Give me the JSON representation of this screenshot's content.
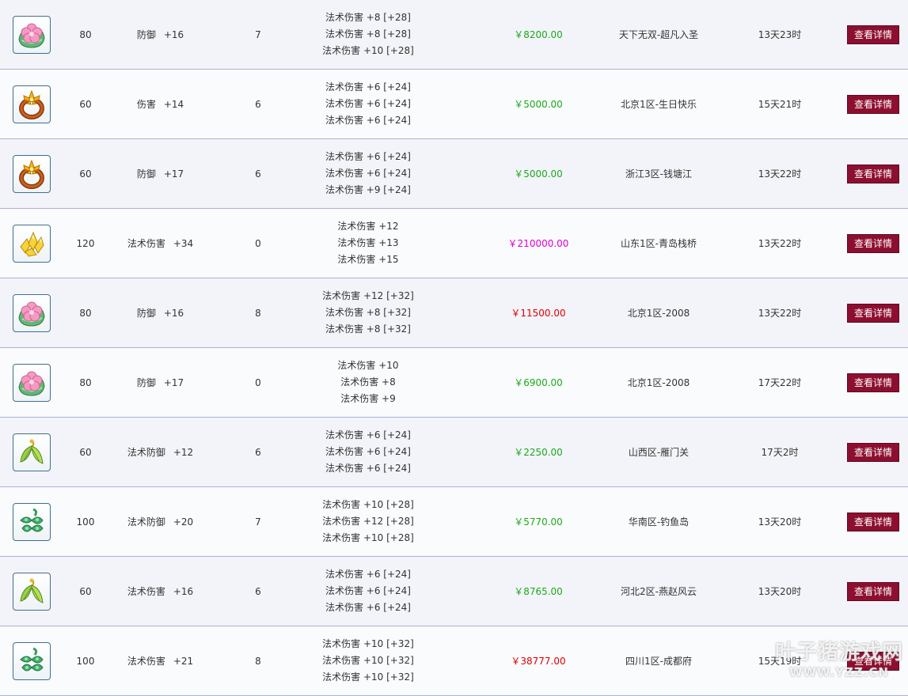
{
  "colors": {
    "row_a": "#f3f4f9",
    "row_b": "#fafbfd",
    "divider": "#a8b2d6",
    "price_green": "#1aaa1a",
    "price_magenta": "#e000d0",
    "price_red": "#e00000",
    "button": "#8d0f2f"
  },
  "rows": [
    {
      "icon": "pink-flower-jade-icon",
      "level": "80",
      "attr_name": "防御",
      "attr_value": "+16",
      "holes": "7",
      "stats": [
        "法术伤害 +8 [+28]",
        "法术伤害 +8 [+28]",
        "法术伤害 +10 [+28]"
      ],
      "price": "￥8200.00",
      "price_color": "green",
      "server": "天下无双-超凡入圣",
      "time": "13天23时",
      "button": "查看详情"
    },
    {
      "icon": "gold-flower-ring-icon",
      "level": "60",
      "attr_name": "伤害",
      "attr_value": "+14",
      "holes": "6",
      "stats": [
        "法术伤害 +6 [+24]",
        "法术伤害 +6 [+24]",
        "法术伤害 +6 [+24]"
      ],
      "price": "￥5000.00",
      "price_color": "green",
      "server": "北京1区-生日快乐",
      "time": "15天21时",
      "button": "查看详情"
    },
    {
      "icon": "gold-flower-ring-icon",
      "level": "60",
      "attr_name": "防御",
      "attr_value": "+17",
      "holes": "6",
      "stats": [
        "法术伤害 +6 [+24]",
        "法术伤害 +6 [+24]",
        "法术伤害 +9 [+24]"
      ],
      "price": "￥5000.00",
      "price_color": "green",
      "server": "浙江3区-钱塘江",
      "time": "13天22时",
      "button": "查看详情"
    },
    {
      "icon": "gold-crystal-icon",
      "level": "120",
      "attr_name": "法术伤害",
      "attr_value": "+34",
      "holes": "0",
      "stats": [
        "法术伤害 +12",
        "法术伤害 +13",
        "法术伤害 +15"
      ],
      "price": "￥210000.00",
      "price_color": "magenta",
      "server": "山东1区-青岛栈桥",
      "time": "13天22时",
      "button": "查看详情"
    },
    {
      "icon": "pink-flower-jade-icon",
      "level": "80",
      "attr_name": "防御",
      "attr_value": "+16",
      "holes": "8",
      "stats": [
        "法术伤害 +12 [+32]",
        "法术伤害 +8 [+32]",
        "法术伤害 +8 [+32]"
      ],
      "price": "￥11500.00",
      "price_color": "red",
      "server": "北京1区-2008",
      "time": "13天22时",
      "button": "查看详情"
    },
    {
      "icon": "pink-flower-jade-icon",
      "level": "80",
      "attr_name": "防御",
      "attr_value": "+17",
      "holes": "0",
      "stats": [
        "法术伤害 +10",
        "法术伤害 +8",
        "法术伤害 +9"
      ],
      "price": "￥6900.00",
      "price_color": "green",
      "server": "北京1区-2008",
      "time": "17天22时",
      "button": "查看详情"
    },
    {
      "icon": "green-leaf-pendant-icon",
      "level": "60",
      "attr_name": "法术防御",
      "attr_value": "+12",
      "holes": "6",
      "stats": [
        "法术伤害 +6 [+24]",
        "法术伤害 +6 [+24]",
        "法术伤害 +6 [+24]"
      ],
      "price": "￥2250.00",
      "price_color": "green",
      "server": "山西区-雁门关",
      "time": "17天2时",
      "button": "查看详情"
    },
    {
      "icon": "jade-leaf-cluster-icon",
      "level": "100",
      "attr_name": "法术防御",
      "attr_value": "+20",
      "holes": "7",
      "stats": [
        "法术伤害 +10 [+28]",
        "法术伤害 +12 [+28]",
        "法术伤害 +10 [+28]"
      ],
      "price": "￥5770.00",
      "price_color": "green",
      "server": "华南区-钓鱼岛",
      "time": "13天20时",
      "button": "查看详情"
    },
    {
      "icon": "green-leaf-pendant-icon",
      "level": "60",
      "attr_name": "法术伤害",
      "attr_value": "+16",
      "holes": "6",
      "stats": [
        "法术伤害 +6 [+24]",
        "法术伤害 +6 [+24]",
        "法术伤害 +6 [+24]"
      ],
      "price": "￥8765.00",
      "price_color": "green",
      "server": "河北2区-燕赵风云",
      "time": "13天20时",
      "button": "查看详情"
    },
    {
      "icon": "jade-leaf-cluster-icon",
      "level": "100",
      "attr_name": "法术伤害",
      "attr_value": "+21",
      "holes": "8",
      "stats": [
        "法术伤害 +10 [+32]",
        "法术伤害 +10 [+32]",
        "法术伤害 +10 [+32]"
      ],
      "price": "￥38777.00",
      "price_color": "red",
      "server": "四川1区-成都府",
      "time": "15天19时",
      "button": "查看详情"
    }
  ],
  "watermark": {
    "main": "叶子猪游戏网",
    "sub": "WWW.YZZ.CN"
  }
}
